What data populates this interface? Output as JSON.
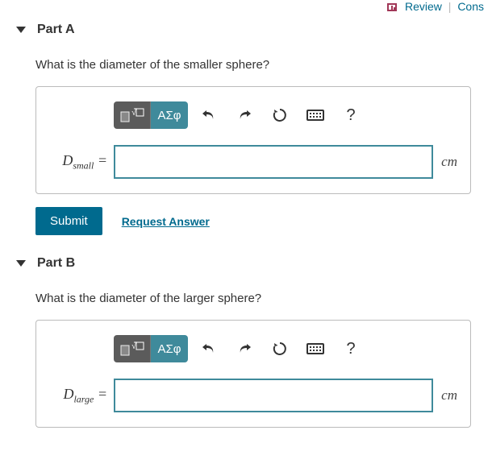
{
  "top": {
    "review": "Review",
    "constants": "Cons"
  },
  "parts": [
    {
      "title": "Part A",
      "question": "What is the diameter of the smaller sphere?",
      "var_main": "D",
      "var_sub": "small",
      "equals": " =",
      "value": "",
      "unit": "cm"
    },
    {
      "title": "Part B",
      "question": "What is the diameter of the larger sphere?",
      "var_main": "D",
      "var_sub": "large",
      "equals": " =",
      "value": "",
      "unit": "cm"
    }
  ],
  "toolbar": {
    "greek": "ΑΣφ",
    "help": "?"
  },
  "actions": {
    "submit": "Submit",
    "request": "Request Answer"
  }
}
